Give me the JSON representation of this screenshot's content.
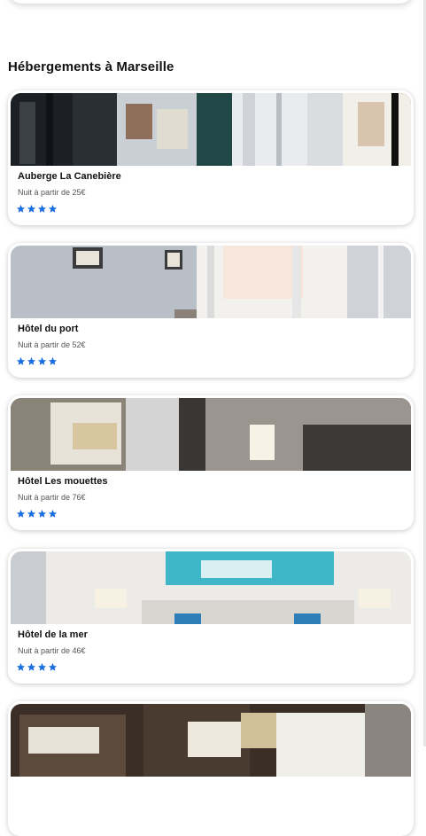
{
  "section": {
    "title": "Hébergements à Marseille"
  },
  "accent_color": "#1a6fe0",
  "hotels": [
    {
      "name": "Auberge La Canebière",
      "price": "Nuit à partir de 25€",
      "stars": 4,
      "photo": "hostel-room-window-photo"
    },
    {
      "name": "Hôtel du port",
      "price": "Nuit à partir de 52€",
      "stars": 4,
      "photo": "bright-room-window-photo"
    },
    {
      "name": "Hôtel Les mouettes",
      "price": "Nuit à partir de 76€",
      "stars": 4,
      "photo": "bedroom-lamp-photo"
    },
    {
      "name": "Hôtel de la mer",
      "price": "Nuit à partir de 46€",
      "stars": 4,
      "photo": "bed-sea-painting-photo"
    },
    {
      "name": "",
      "price": "",
      "stars": 0,
      "photo": "bunk-beds-photo"
    }
  ]
}
